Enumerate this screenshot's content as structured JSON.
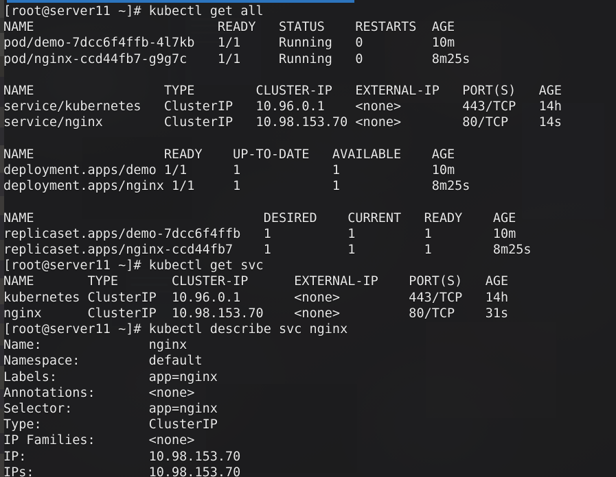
{
  "window": {
    "title_accent_color": "#2c74bd",
    "terminal_background": "#1a1a1c",
    "text_color": "#e8e8e8",
    "prompt": "[root@server11 ~]#"
  },
  "session": {
    "user": "root",
    "host": "server11",
    "cwd": "~",
    "prompt_symbol": "#"
  },
  "commands": [
    {
      "id": "cmd1",
      "prompt": "[root@server11 ~]#",
      "text": "kubectl get all"
    },
    {
      "id": "cmd2",
      "prompt": "[root@server11 ~]#",
      "text": "kubectl get svc"
    },
    {
      "id": "cmd3",
      "prompt": "[root@server11 ~]#",
      "text": "kubectl describe svc nginx"
    }
  ],
  "get_all_output": {
    "pods": {
      "headers": [
        "NAME",
        "READY",
        "STATUS",
        "RESTARTS",
        "AGE"
      ],
      "rows": [
        [
          "pod/demo-7dcc6f4ffb-4l7kb",
          "1/1",
          "Running",
          "0",
          "10m"
        ],
        [
          "pod/nginx-ccd44fb7-g9g7c",
          "1/1",
          "Running",
          "0",
          "8m25s"
        ]
      ]
    },
    "services": {
      "headers": [
        "NAME",
        "TYPE",
        "CLUSTER-IP",
        "EXTERNAL-IP",
        "PORT(S)",
        "AGE"
      ],
      "rows": [
        [
          "service/kubernetes",
          "ClusterIP",
          "10.96.0.1",
          "<none>",
          "443/TCP",
          "14h"
        ],
        [
          "service/nginx",
          "ClusterIP",
          "10.98.153.70",
          "<none>",
          "80/TCP",
          "14s"
        ]
      ]
    },
    "deployments": {
      "headers": [
        "NAME",
        "READY",
        "UP-TO-DATE",
        "AVAILABLE",
        "AGE"
      ],
      "rows": [
        [
          "deployment.apps/demo",
          "1/1",
          "1",
          "1",
          "10m"
        ],
        [
          "deployment.apps/nginx",
          "1/1",
          "1",
          "1",
          "8m25s"
        ]
      ]
    },
    "replicasets": {
      "headers": [
        "NAME",
        "DESIRED",
        "CURRENT",
        "READY",
        "AGE"
      ],
      "rows": [
        [
          "replicaset.apps/demo-7dcc6f4ffb",
          "1",
          "1",
          "1",
          "10m"
        ],
        [
          "replicaset.apps/nginx-ccd44fb7",
          "1",
          "1",
          "1",
          "8m25s"
        ]
      ]
    }
  },
  "get_svc_output": {
    "headers": [
      "NAME",
      "TYPE",
      "CLUSTER-IP",
      "EXTERNAL-IP",
      "PORT(S)",
      "AGE"
    ],
    "rows": [
      [
        "kubernetes",
        "ClusterIP",
        "10.96.0.1",
        "<none>",
        "443/TCP",
        "14h"
      ],
      [
        "nginx",
        "ClusterIP",
        "10.98.153.70",
        "<none>",
        "80/TCP",
        "31s"
      ]
    ]
  },
  "describe_output": {
    "fields": [
      {
        "label": "Name:",
        "value": "nginx"
      },
      {
        "label": "Namespace:",
        "value": "default"
      },
      {
        "label": "Labels:",
        "value": "app=nginx"
      },
      {
        "label": "Annotations:",
        "value": "<none>"
      },
      {
        "label": "Selector:",
        "value": "app=nginx"
      },
      {
        "label": "Type:",
        "value": "ClusterIP"
      },
      {
        "label": "IP Families:",
        "value": "<none>"
      },
      {
        "label": "IP:",
        "value": "10.98.153.70"
      },
      {
        "label": "IPs:",
        "value": "10.98.153.70"
      }
    ]
  },
  "layout": {
    "pod_cols": [
      0,
      28,
      36,
      46,
      56
    ],
    "service_cols": [
      0,
      21,
      33,
      46,
      60,
      70
    ],
    "deploy_cols": [
      0,
      21,
      30,
      43,
      56
    ],
    "replicaset_cols": [
      0,
      34,
      45,
      55,
      64
    ],
    "svc_cols": [
      0,
      11,
      22,
      38,
      53,
      63
    ],
    "describe_value_col": 19
  }
}
